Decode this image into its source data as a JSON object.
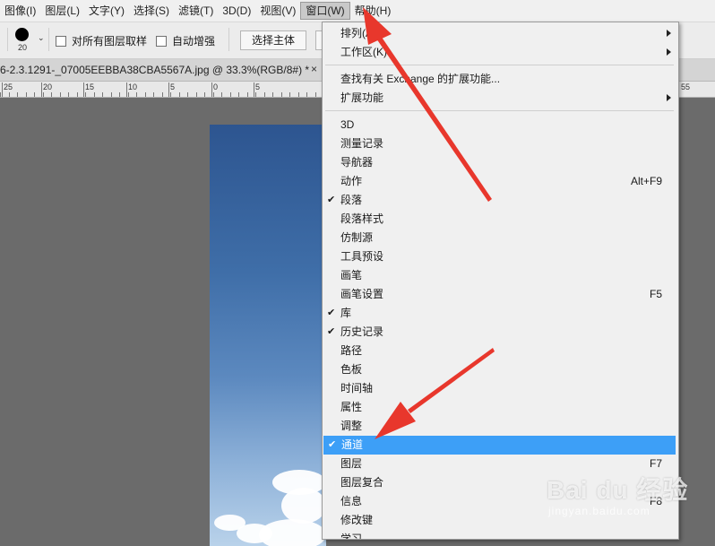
{
  "menubar": {
    "items": [
      "图像(I)",
      "图层(L)",
      "文字(Y)",
      "选择(S)",
      "滤镜(T)",
      "3D(D)",
      "视图(V)",
      "窗口(W)",
      "帮助(H)"
    ],
    "active_index": 7
  },
  "options": {
    "brush_size": "20",
    "sample_all_layers": "对所有图层取样",
    "auto_enhance": "自动增强",
    "select_subject": "选择主体"
  },
  "document": {
    "title": "6-2.3.1291-_07005EEBBA38CBA5567A.jpg @ 33.3%(RGB/8#) *",
    "close": "×"
  },
  "ruler": {
    "labels": [
      "25",
      "20",
      "15",
      "10",
      "5",
      "0",
      "5"
    ],
    "right_label": "55"
  },
  "window_menu": {
    "groups": [
      [
        {
          "label": "排列(A)",
          "submenu": true
        },
        {
          "label": "工作区(K)",
          "submenu": true
        }
      ],
      [
        {
          "label": "查找有关 Exchange 的扩展功能..."
        },
        {
          "label": "扩展功能",
          "submenu": true
        }
      ],
      [
        {
          "label": "3D"
        },
        {
          "label": "测量记录"
        },
        {
          "label": "导航器"
        },
        {
          "label": "动作",
          "shortcut": "Alt+F9"
        },
        {
          "label": "段落",
          "checked": true
        },
        {
          "label": "段落样式"
        },
        {
          "label": "仿制源"
        },
        {
          "label": "工具预设"
        },
        {
          "label": "画笔"
        },
        {
          "label": "画笔设置",
          "shortcut": "F5"
        },
        {
          "label": "库",
          "checked": true
        },
        {
          "label": "历史记录",
          "checked": true
        },
        {
          "label": "路径"
        },
        {
          "label": "色板"
        },
        {
          "label": "时间轴"
        },
        {
          "label": "属性"
        },
        {
          "label": "调整"
        },
        {
          "label": "通道",
          "checked": true,
          "highlighted": true
        },
        {
          "label": "图层",
          "shortcut": "F7"
        },
        {
          "label": "图层复合"
        },
        {
          "label": "信息",
          "shortcut": "F8"
        },
        {
          "label": "修改键"
        },
        {
          "label": "学习"
        }
      ]
    ]
  },
  "watermark": {
    "logo": "Bai du 经验",
    "url": "jingyan.baidu.com"
  },
  "colors": {
    "highlight": "#3d9ff7",
    "arrow": "#e8372c",
    "menu_bg": "#f0f0f0",
    "workspace_bg": "#6b6b6b"
  },
  "icons": {
    "check": "checkmark-icon",
    "submenu": "chevron-right-icon",
    "brush": "brush-tip-icon"
  }
}
